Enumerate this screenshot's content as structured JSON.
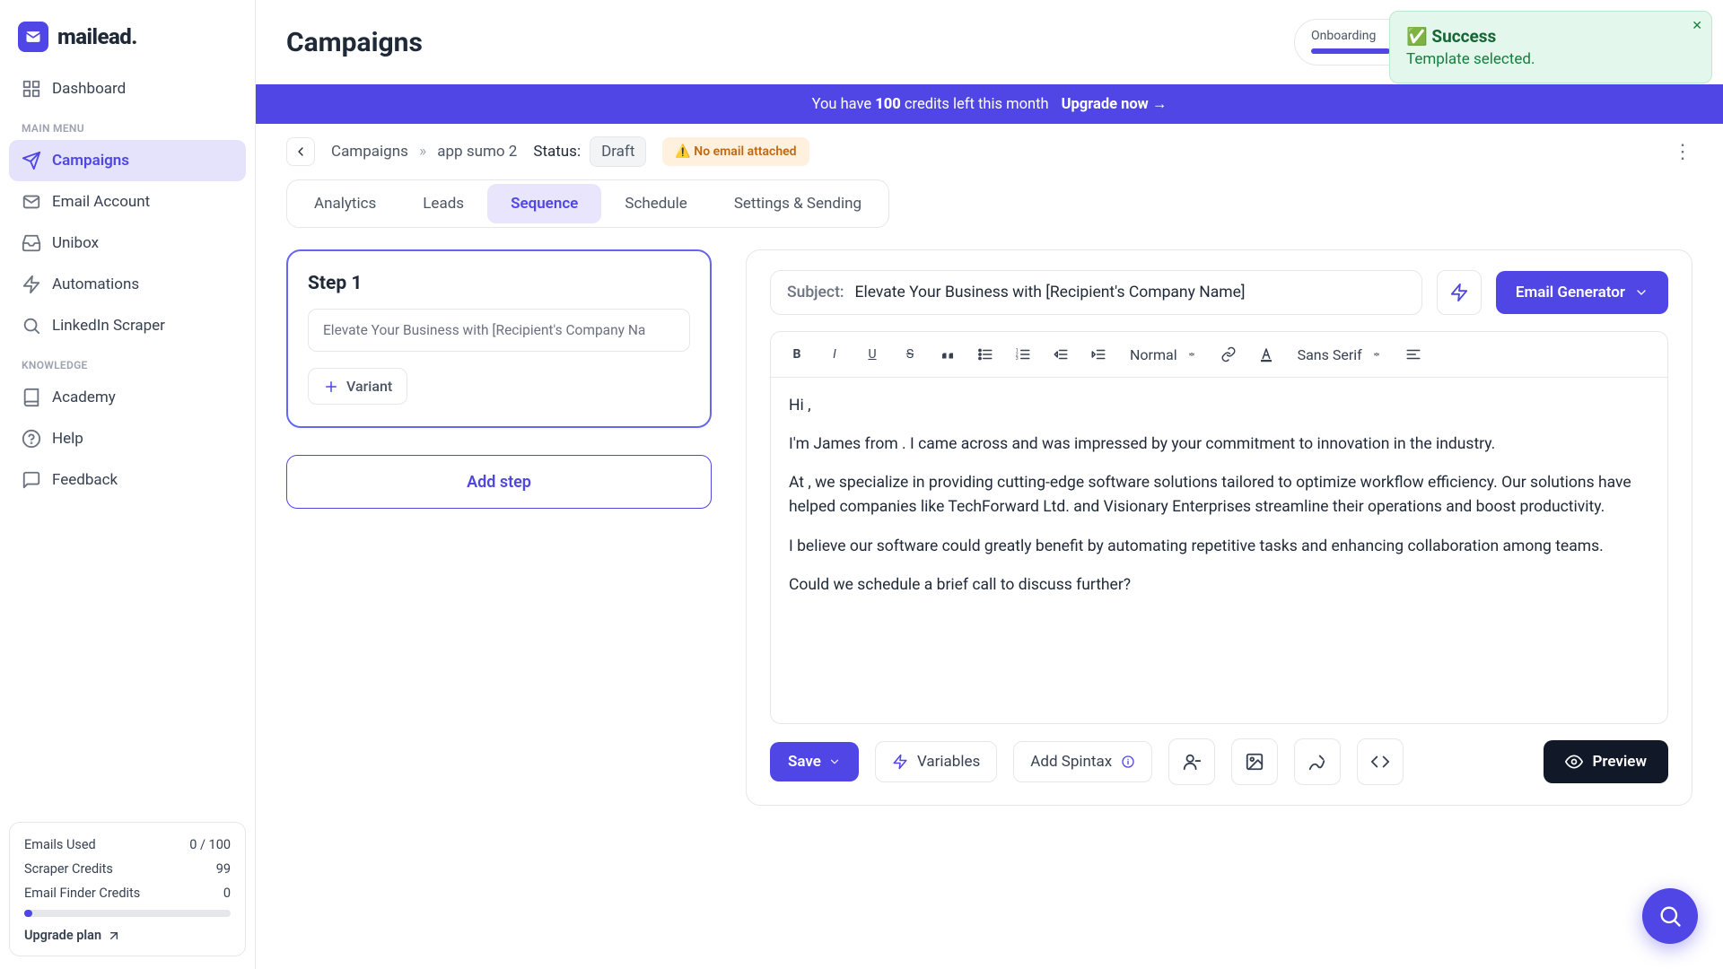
{
  "brand": "mailead.",
  "page_title": "Campaigns",
  "onboarding": {
    "label": "Onboarding",
    "progress_text": ""
  },
  "avatar_initial": "",
  "banner": {
    "prefix": "You have ",
    "count": "100",
    "suffix": " credits left this month",
    "cta": "Upgrade now →"
  },
  "breadcrumb": {
    "root": "Campaigns",
    "sep": "»",
    "current": "app sumo 2"
  },
  "status": {
    "label": "Status:",
    "value": "Draft"
  },
  "warning": "⚠️ No email attached",
  "tabs": [
    "Analytics",
    "Leads",
    "Sequence",
    "Schedule",
    "Settings & Sending"
  ],
  "active_tab": "Sequence",
  "sidebar": {
    "main_label": "MAIN MENU",
    "items": [
      "Dashboard",
      "Campaigns",
      "Email Account",
      "Unibox",
      "Automations",
      "LinkedIn Scraper"
    ],
    "knowledge_label": "KNOWLEDGE",
    "knowledge_items": [
      "Academy",
      "Help",
      "Feedback"
    ]
  },
  "credits": {
    "rows": [
      {
        "label": "Emails Used",
        "value": "0 / 100"
      },
      {
        "label": "Scraper Credits",
        "value": "99"
      },
      {
        "label": "Email Finder Credits",
        "value": "0"
      }
    ],
    "upgrade": "Upgrade plan"
  },
  "step": {
    "title": "Step 1",
    "subject_preview": "Elevate Your Business with [Recipient's Company Na",
    "variant": "Variant",
    "add_step": "Add step"
  },
  "editor": {
    "subject_label": "Subject:",
    "subject": "Elevate Your Business with [Recipient's Company Name]",
    "email_generator": "Email Generator",
    "heading_sel": "Normal",
    "font_sel": "Sans Serif",
    "body": [
      "Hi ,",
      "I'm James from . I came across  and was impressed by your commitment to innovation in the  industry.",
      "At , we specialize in providing cutting-edge software solutions tailored to optimize workflow efficiency. Our solutions have helped companies like TechForward Ltd. and Visionary Enterprises streamline their operations and boost productivity.",
      "I believe our software could greatly benefit  by automating repetitive tasks and enhancing collaboration among teams.",
      "Could we schedule a brief call to discuss further?"
    ],
    "save": "Save",
    "variables": "Variables",
    "spintax": "Add Spintax",
    "preview": "Preview"
  },
  "toast": {
    "title": "✅ Success",
    "sub": "Template selected."
  }
}
